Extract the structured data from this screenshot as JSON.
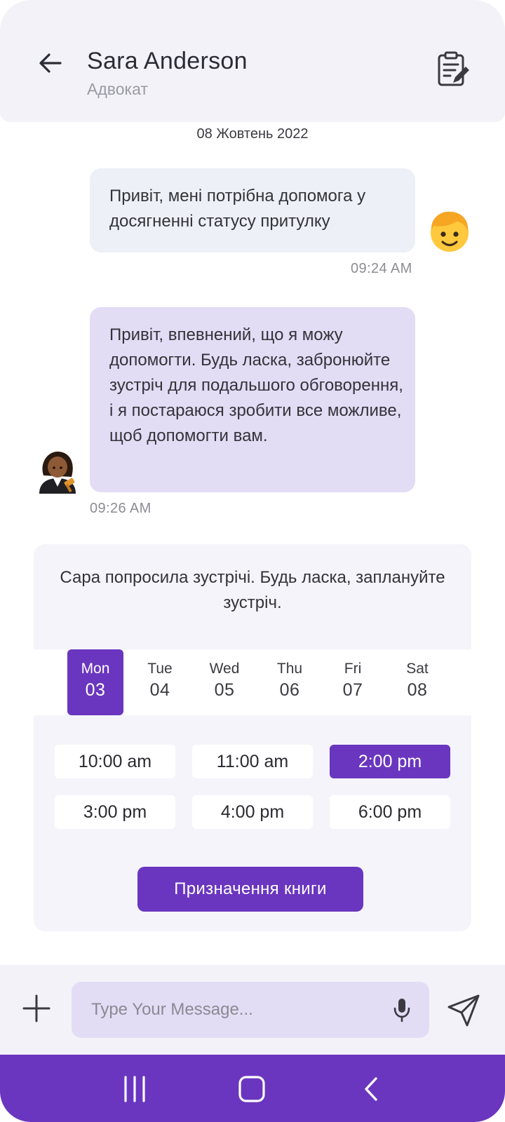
{
  "header": {
    "name": "Sara Anderson",
    "role": "Адвокат",
    "icons": {
      "back": "arrow-left-icon",
      "notes": "notes-edit-icon"
    }
  },
  "date_separator": "08 Жовтень 2022",
  "messages": [
    {
      "sender": "user",
      "text": "Привіт, мені потрібна допомога у досягненні статусу притулку",
      "time": "09:24 AM"
    },
    {
      "sender": "lawyer",
      "text": "Привіт, впевнений, що я можу допомогти. Будь ласка, забронюйте зустріч для подальшого обговорення, і я постараюся зробити все можливе, щоб допомогти вам.",
      "time": "09:26 AM"
    }
  ],
  "booking": {
    "prompt": "Сара попросила зустрічі. Будь ласка, заплануйте зустріч.",
    "days": [
      {
        "name": "Mon",
        "num": "03",
        "selected": true
      },
      {
        "name": "Tue",
        "num": "04",
        "selected": false
      },
      {
        "name": "Wed",
        "num": "05",
        "selected": false
      },
      {
        "name": "Thu",
        "num": "06",
        "selected": false
      },
      {
        "name": "Fri",
        "num": "07",
        "selected": false
      },
      {
        "name": "Sat",
        "num": "08",
        "selected": false
      }
    ],
    "slots": [
      {
        "label": "10:00 am",
        "selected": false
      },
      {
        "label": "11:00 am",
        "selected": false
      },
      {
        "label": "2:00 pm",
        "selected": true
      },
      {
        "label": "3:00 pm",
        "selected": false
      },
      {
        "label": "4:00 pm",
        "selected": false
      },
      {
        "label": "6:00 pm",
        "selected": false
      }
    ],
    "button_label": "Призначення книги"
  },
  "composer": {
    "placeholder": "Type Your Message...",
    "icons": {
      "add": "plus-icon",
      "mic": "microphone-icon",
      "send": "send-icon"
    }
  },
  "navbar": {
    "icons": [
      "recents-icon",
      "home-icon",
      "back-chevron-icon"
    ]
  },
  "colors": {
    "accent": "#6a36bf",
    "header_bg": "#f3f2f8",
    "outgoing_bubble": "#edf0f7",
    "incoming_bubble": "#e2dcf5",
    "card_bg": "#f5f4fa"
  }
}
